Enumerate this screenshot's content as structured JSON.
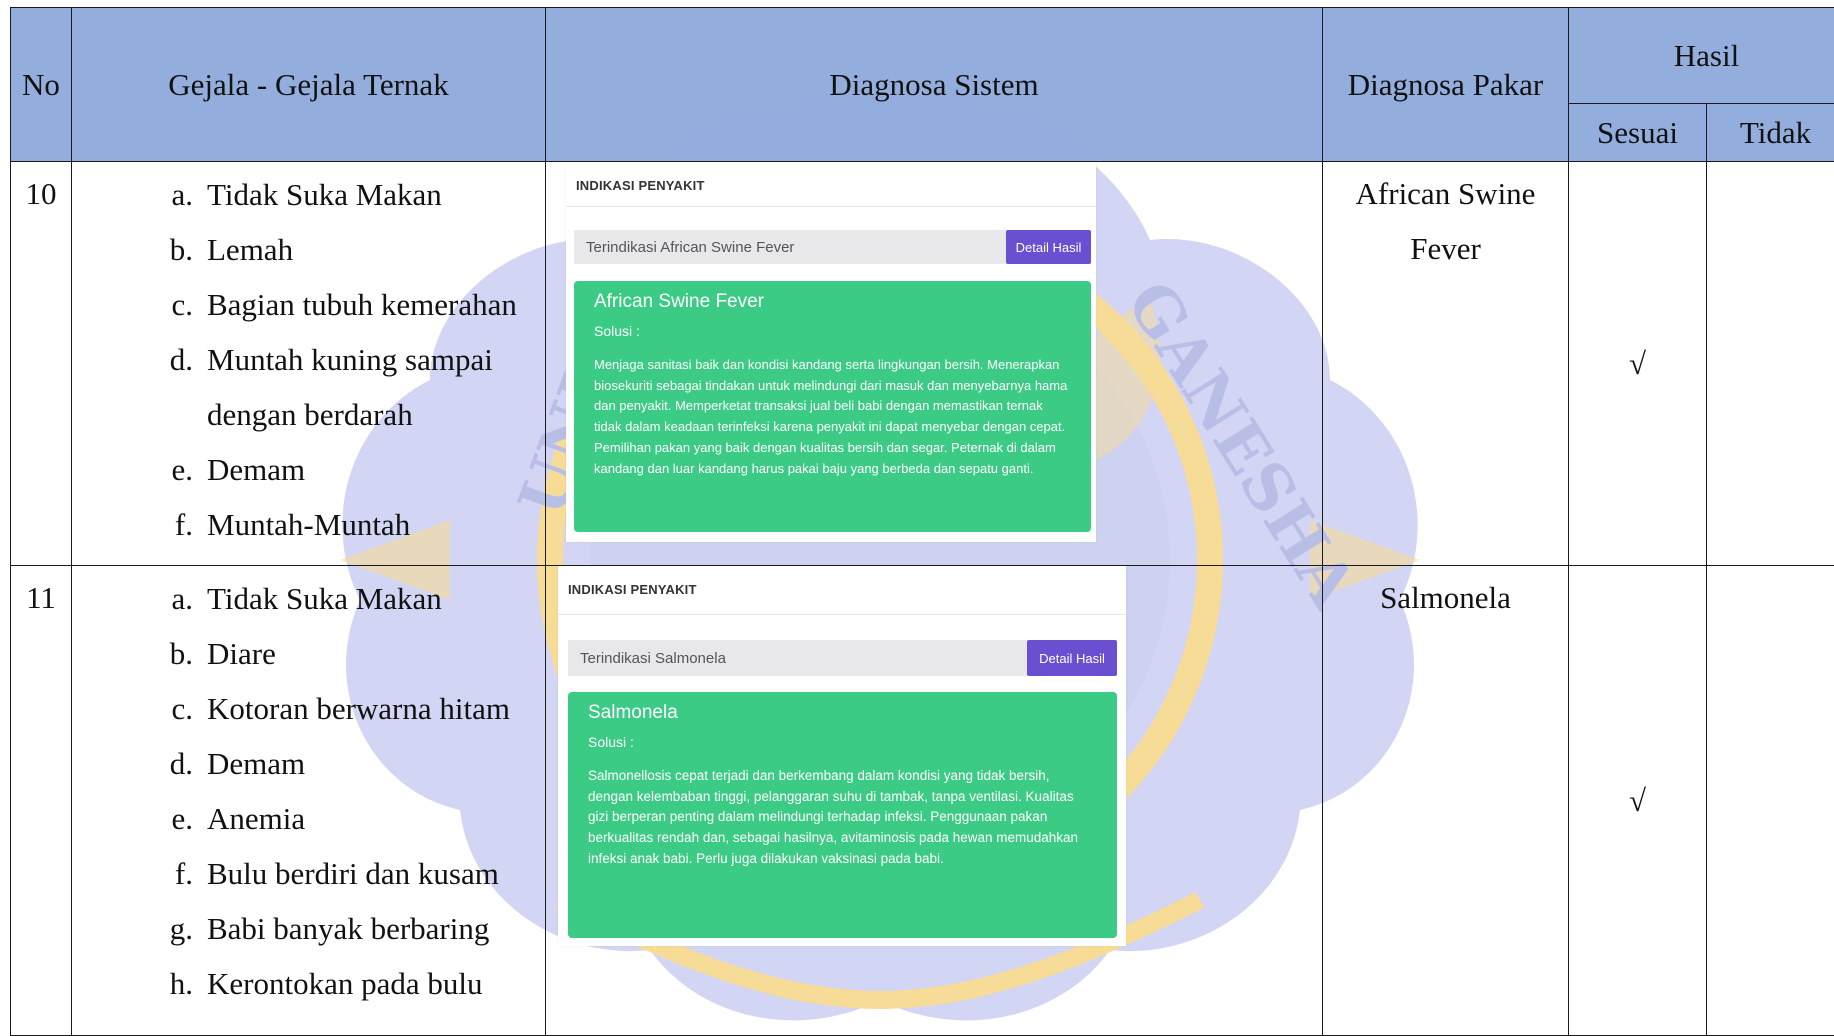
{
  "header": {
    "no": "No",
    "gejala": "Gejala - Gejala Ternak",
    "sistem": "Diagnosa Sistem",
    "pakar": "Diagnosa Pakar",
    "hasil": "Hasil",
    "sesuai": "Sesuai",
    "tidak": "Tidak"
  },
  "rows": [
    {
      "no": "10",
      "gejala": [
        {
          "letter": "a.",
          "text": "Tidak Suka Makan"
        },
        {
          "letter": "b.",
          "text": "Lemah"
        },
        {
          "letter": "c.",
          "text": "Bagian tubuh kemerahan"
        },
        {
          "letter": "d.",
          "text": "Muntah kuning sampai dengan berdarah"
        },
        {
          "letter": "e.",
          "text": "Demam"
        },
        {
          "letter": "f.",
          "text": "Muntah-Muntah"
        }
      ],
      "panel": {
        "heading": "INDIKASI PENYAKIT",
        "input_value": "Terindikasi African Swine Fever",
        "button_label": "Detail Hasil",
        "card_title": "African Swine Fever",
        "card_subtitle": "Solusi :",
        "card_body": "Menjaga sanitasi baik dan kondisi kandang serta lingkungan bersih. Menerapkan biosekuriti sebagai tindakan untuk melindungi dari masuk dan menyebarnya hama dan penyakit. Memperketat transaksi jual beli babi dengan memastikan ternak tidak dalam keadaan terinfeksi karena penyakit ini dapat menyebar dengan cepat. Pemilihan pakan yang baik dengan kualitas bersih dan segar. Peternak di dalam kandang dan luar kandang harus pakai baju yang berbeda dan sepatu ganti."
      },
      "pakar": "African Swine Fever",
      "sesuai": "√",
      "tidak": ""
    },
    {
      "no": "11",
      "gejala": [
        {
          "letter": "a.",
          "text": "Tidak Suka Makan"
        },
        {
          "letter": "b.",
          "text": "Diare"
        },
        {
          "letter": "c.",
          "text": "Kotoran berwarna hitam"
        },
        {
          "letter": "d.",
          "text": "Demam"
        },
        {
          "letter": "e.",
          "text": "Anemia"
        },
        {
          "letter": "f.",
          "text": "Bulu berdiri dan kusam"
        },
        {
          "letter": "g.",
          "text": "Babi banyak berbaring"
        },
        {
          "letter": "h.",
          "text": "Kerontokan pada bulu"
        }
      ],
      "panel": {
        "heading": "INDIKASI PENYAKIT",
        "input_value": "Terindikasi Salmonela",
        "button_label": "Detail Hasil",
        "card_title": "Salmonela",
        "card_subtitle": "Solusi :",
        "card_body": "Salmonellosis cepat terjadi dan berkembang dalam kondisi yang tidak bersih, dengan kelembaban tinggi, pelanggaran suhu di tambak, tanpa ventilasi. Kualitas gizi berperan penting dalam melindungi terhadap infeksi. Penggunaan pakan berkualitas rendah dan, sebagai hasilnya, avitaminosis pada hewan memudahkan infeksi anak babi. Perlu juga dilakukan vaksinasi pada babi."
      },
      "pakar": "Salmonela",
      "sesuai": "√",
      "tidak": ""
    }
  ],
  "watermark": {
    "text": "UNIVERSITAS PENDIDIKAN GANESHA",
    "colors": {
      "lavender": "#cfd3f2",
      "gold": "#f5d58a"
    }
  },
  "colors": {
    "header_bg": "#8faadc",
    "button_bg": "#6a4fd0",
    "card_bg": "#3ccb85"
  }
}
